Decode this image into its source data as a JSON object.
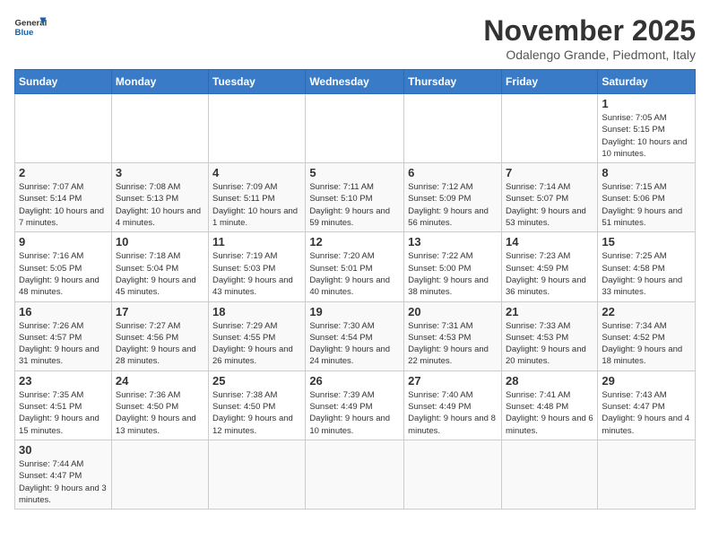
{
  "header": {
    "logo_general": "General",
    "logo_blue": "Blue",
    "month": "November 2025",
    "location": "Odalengo Grande, Piedmont, Italy"
  },
  "days_of_week": [
    "Sunday",
    "Monday",
    "Tuesday",
    "Wednesday",
    "Thursday",
    "Friday",
    "Saturday"
  ],
  "weeks": [
    {
      "days": [
        {
          "date": "",
          "info": ""
        },
        {
          "date": "",
          "info": ""
        },
        {
          "date": "",
          "info": ""
        },
        {
          "date": "",
          "info": ""
        },
        {
          "date": "",
          "info": ""
        },
        {
          "date": "",
          "info": ""
        },
        {
          "date": "1",
          "info": "Sunrise: 7:05 AM\nSunset: 5:15 PM\nDaylight: 10 hours and 10 minutes."
        }
      ]
    },
    {
      "days": [
        {
          "date": "2",
          "info": "Sunrise: 7:07 AM\nSunset: 5:14 PM\nDaylight: 10 hours and 7 minutes."
        },
        {
          "date": "3",
          "info": "Sunrise: 7:08 AM\nSunset: 5:13 PM\nDaylight: 10 hours and 4 minutes."
        },
        {
          "date": "4",
          "info": "Sunrise: 7:09 AM\nSunset: 5:11 PM\nDaylight: 10 hours and 1 minute."
        },
        {
          "date": "5",
          "info": "Sunrise: 7:11 AM\nSunset: 5:10 PM\nDaylight: 9 hours and 59 minutes."
        },
        {
          "date": "6",
          "info": "Sunrise: 7:12 AM\nSunset: 5:09 PM\nDaylight: 9 hours and 56 minutes."
        },
        {
          "date": "7",
          "info": "Sunrise: 7:14 AM\nSunset: 5:07 PM\nDaylight: 9 hours and 53 minutes."
        },
        {
          "date": "8",
          "info": "Sunrise: 7:15 AM\nSunset: 5:06 PM\nDaylight: 9 hours and 51 minutes."
        }
      ]
    },
    {
      "days": [
        {
          "date": "9",
          "info": "Sunrise: 7:16 AM\nSunset: 5:05 PM\nDaylight: 9 hours and 48 minutes."
        },
        {
          "date": "10",
          "info": "Sunrise: 7:18 AM\nSunset: 5:04 PM\nDaylight: 9 hours and 45 minutes."
        },
        {
          "date": "11",
          "info": "Sunrise: 7:19 AM\nSunset: 5:03 PM\nDaylight: 9 hours and 43 minutes."
        },
        {
          "date": "12",
          "info": "Sunrise: 7:20 AM\nSunset: 5:01 PM\nDaylight: 9 hours and 40 minutes."
        },
        {
          "date": "13",
          "info": "Sunrise: 7:22 AM\nSunset: 5:00 PM\nDaylight: 9 hours and 38 minutes."
        },
        {
          "date": "14",
          "info": "Sunrise: 7:23 AM\nSunset: 4:59 PM\nDaylight: 9 hours and 36 minutes."
        },
        {
          "date": "15",
          "info": "Sunrise: 7:25 AM\nSunset: 4:58 PM\nDaylight: 9 hours and 33 minutes."
        }
      ]
    },
    {
      "days": [
        {
          "date": "16",
          "info": "Sunrise: 7:26 AM\nSunset: 4:57 PM\nDaylight: 9 hours and 31 minutes."
        },
        {
          "date": "17",
          "info": "Sunrise: 7:27 AM\nSunset: 4:56 PM\nDaylight: 9 hours and 28 minutes."
        },
        {
          "date": "18",
          "info": "Sunrise: 7:29 AM\nSunset: 4:55 PM\nDaylight: 9 hours and 26 minutes."
        },
        {
          "date": "19",
          "info": "Sunrise: 7:30 AM\nSunset: 4:54 PM\nDaylight: 9 hours and 24 minutes."
        },
        {
          "date": "20",
          "info": "Sunrise: 7:31 AM\nSunset: 4:53 PM\nDaylight: 9 hours and 22 minutes."
        },
        {
          "date": "21",
          "info": "Sunrise: 7:33 AM\nSunset: 4:53 PM\nDaylight: 9 hours and 20 minutes."
        },
        {
          "date": "22",
          "info": "Sunrise: 7:34 AM\nSunset: 4:52 PM\nDaylight: 9 hours and 18 minutes."
        }
      ]
    },
    {
      "days": [
        {
          "date": "23",
          "info": "Sunrise: 7:35 AM\nSunset: 4:51 PM\nDaylight: 9 hours and 15 minutes."
        },
        {
          "date": "24",
          "info": "Sunrise: 7:36 AM\nSunset: 4:50 PM\nDaylight: 9 hours and 13 minutes."
        },
        {
          "date": "25",
          "info": "Sunrise: 7:38 AM\nSunset: 4:50 PM\nDaylight: 9 hours and 12 minutes."
        },
        {
          "date": "26",
          "info": "Sunrise: 7:39 AM\nSunset: 4:49 PM\nDaylight: 9 hours and 10 minutes."
        },
        {
          "date": "27",
          "info": "Sunrise: 7:40 AM\nSunset: 4:49 PM\nDaylight: 9 hours and 8 minutes."
        },
        {
          "date": "28",
          "info": "Sunrise: 7:41 AM\nSunset: 4:48 PM\nDaylight: 9 hours and 6 minutes."
        },
        {
          "date": "29",
          "info": "Sunrise: 7:43 AM\nSunset: 4:47 PM\nDaylight: 9 hours and 4 minutes."
        }
      ]
    },
    {
      "days": [
        {
          "date": "30",
          "info": "Sunrise: 7:44 AM\nSunset: 4:47 PM\nDaylight: 9 hours and 3 minutes."
        },
        {
          "date": "",
          "info": ""
        },
        {
          "date": "",
          "info": ""
        },
        {
          "date": "",
          "info": ""
        },
        {
          "date": "",
          "info": ""
        },
        {
          "date": "",
          "info": ""
        },
        {
          "date": "",
          "info": ""
        }
      ]
    }
  ]
}
